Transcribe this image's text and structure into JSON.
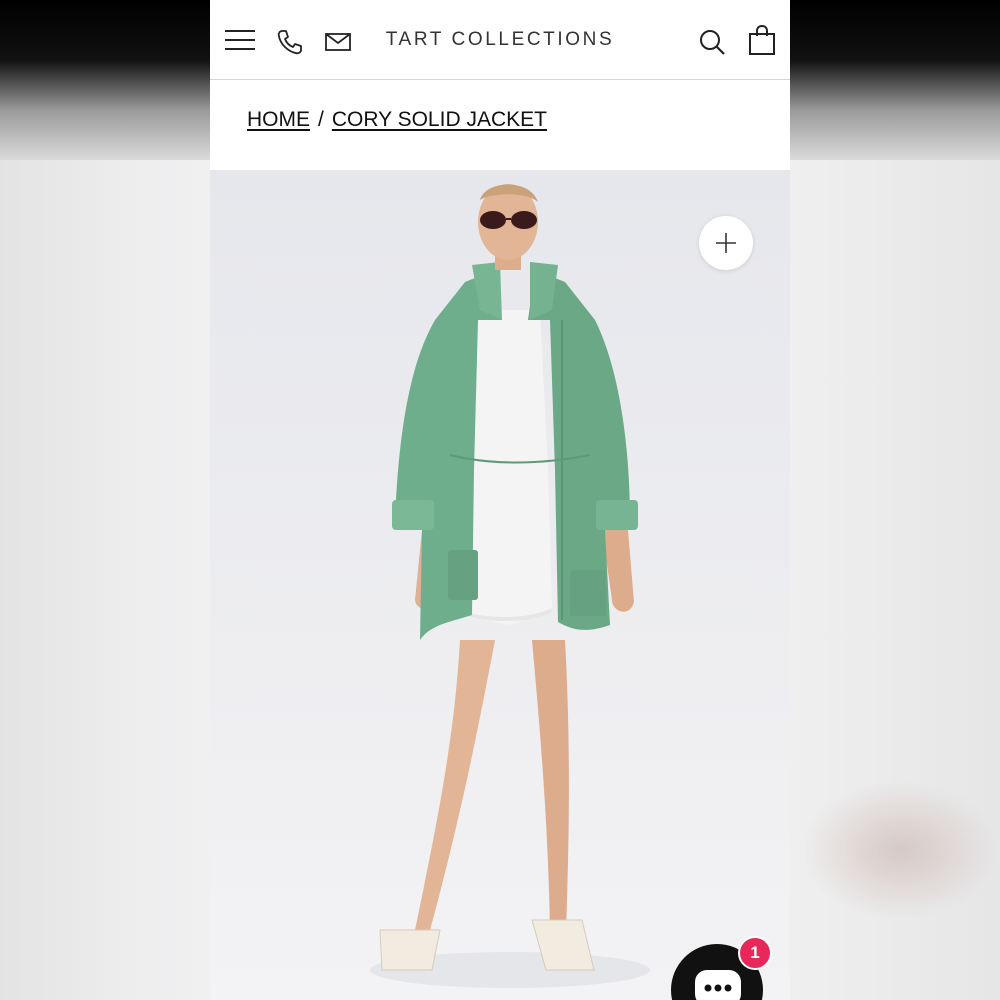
{
  "header": {
    "brand": "TART COLLECTIONS",
    "icons": [
      "menu-icon",
      "phone-icon",
      "mail-icon",
      "search-icon",
      "shopping-bag-icon"
    ]
  },
  "breadcrumb": {
    "home": "HOME",
    "separator": "/",
    "current": "CORY SOLID JACKET"
  },
  "product": {
    "image_description_icon": "model-in-green-jacket",
    "jacket_color": "#6fae8c",
    "zoom_icon": "plus-icon"
  },
  "chat": {
    "icon": "chat-icon",
    "badge_count": "1",
    "badge_color": "#e8285a"
  }
}
